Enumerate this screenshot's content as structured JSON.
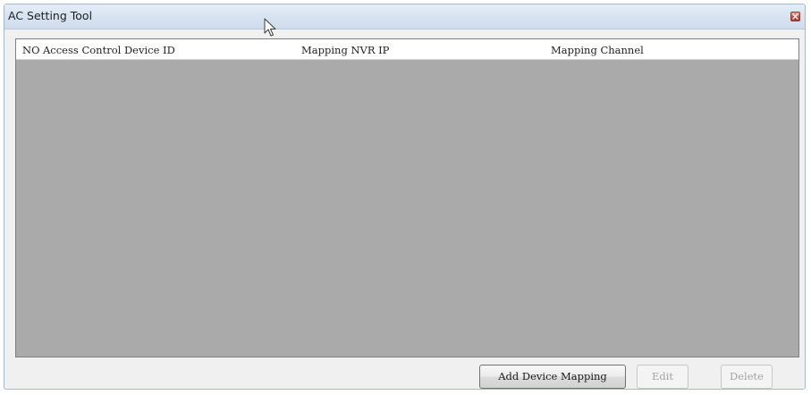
{
  "window": {
    "title": "AC Setting Tool"
  },
  "table": {
    "columns": [
      "NO",
      "Access Control Device ID",
      "Mapping NVR IP",
      "Mapping Channel"
    ],
    "rows": []
  },
  "buttons": {
    "add_label": "Add Device Mapping",
    "edit_label": "Edit",
    "delete_label": "Delete"
  },
  "icons": {
    "close": "close-icon",
    "cursor": "mouse-cursor-icon"
  }
}
